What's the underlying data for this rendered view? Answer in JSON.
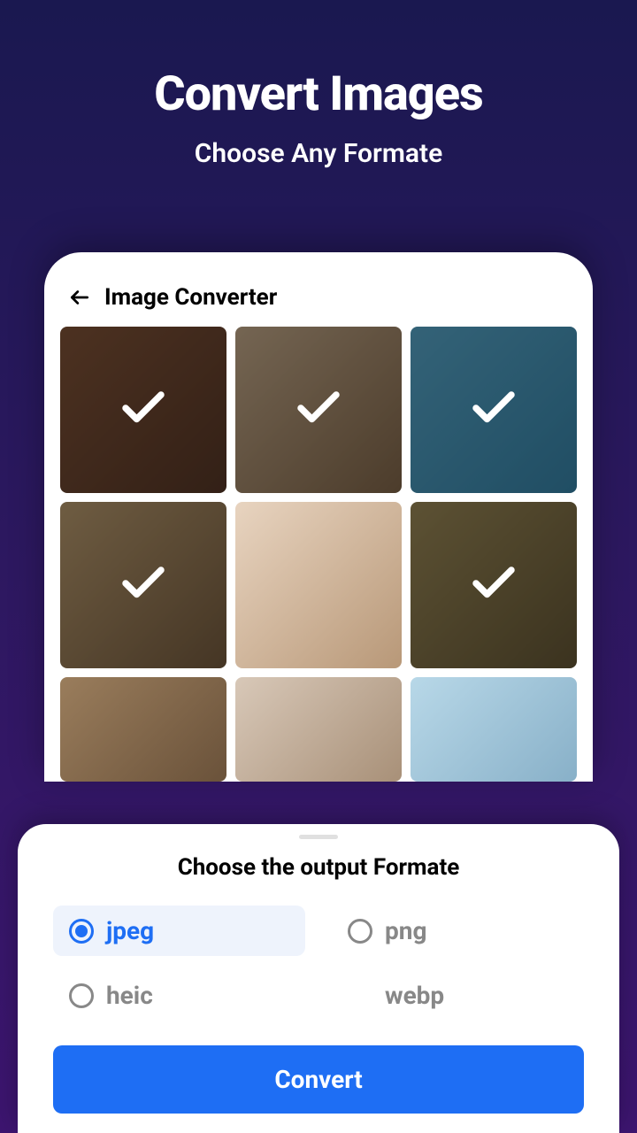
{
  "hero": {
    "title": "Convert Images",
    "subtitle": "Choose Any Formate"
  },
  "app": {
    "title": "Image Converter"
  },
  "grid": {
    "items": [
      {
        "selected": true
      },
      {
        "selected": true
      },
      {
        "selected": true
      },
      {
        "selected": true
      },
      {
        "selected": false
      },
      {
        "selected": true
      },
      {
        "selected": false
      },
      {
        "selected": false
      },
      {
        "selected": false
      }
    ]
  },
  "sheet": {
    "title": "Choose the output Formate",
    "formats": [
      {
        "label": "jpeg",
        "selected": true,
        "hasRadio": true
      },
      {
        "label": "png",
        "selected": false,
        "hasRadio": true
      },
      {
        "label": "heic",
        "selected": false,
        "hasRadio": true
      },
      {
        "label": "webp",
        "selected": false,
        "hasRadio": false
      }
    ],
    "button": "Convert"
  }
}
